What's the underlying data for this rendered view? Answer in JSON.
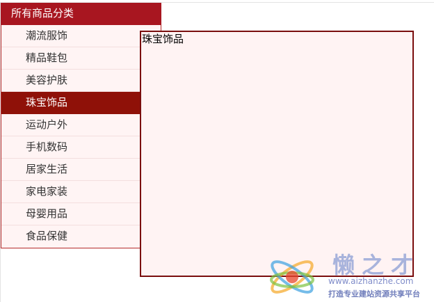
{
  "menu": {
    "header": "所有商品分类",
    "active_index": 3,
    "items": [
      {
        "label": "潮流服饰"
      },
      {
        "label": "精品鞋包"
      },
      {
        "label": "美容护肤"
      },
      {
        "label": "珠宝饰品"
      },
      {
        "label": "运动户外"
      },
      {
        "label": "手机数码"
      },
      {
        "label": "居家生活"
      },
      {
        "label": "家电家装"
      },
      {
        "label": "母婴用品"
      },
      {
        "label": "食品保健"
      }
    ]
  },
  "panel": {
    "title": "珠宝饰品"
  },
  "watermark": {
    "name": "懒之才",
    "url": "www.aizhanzhe.com",
    "slogan": "打造专业建站资源共享平台",
    "colors": [
      "#e8452c",
      "#f5a623",
      "#3aa0e0",
      "#7dc242"
    ]
  },
  "colors": {
    "header_bg": "#a81620",
    "active_bg": "#8f1108",
    "item_bg": "#fff4f4",
    "panel_bg": "#fff3f3",
    "panel_border": "#7a0d0d"
  }
}
